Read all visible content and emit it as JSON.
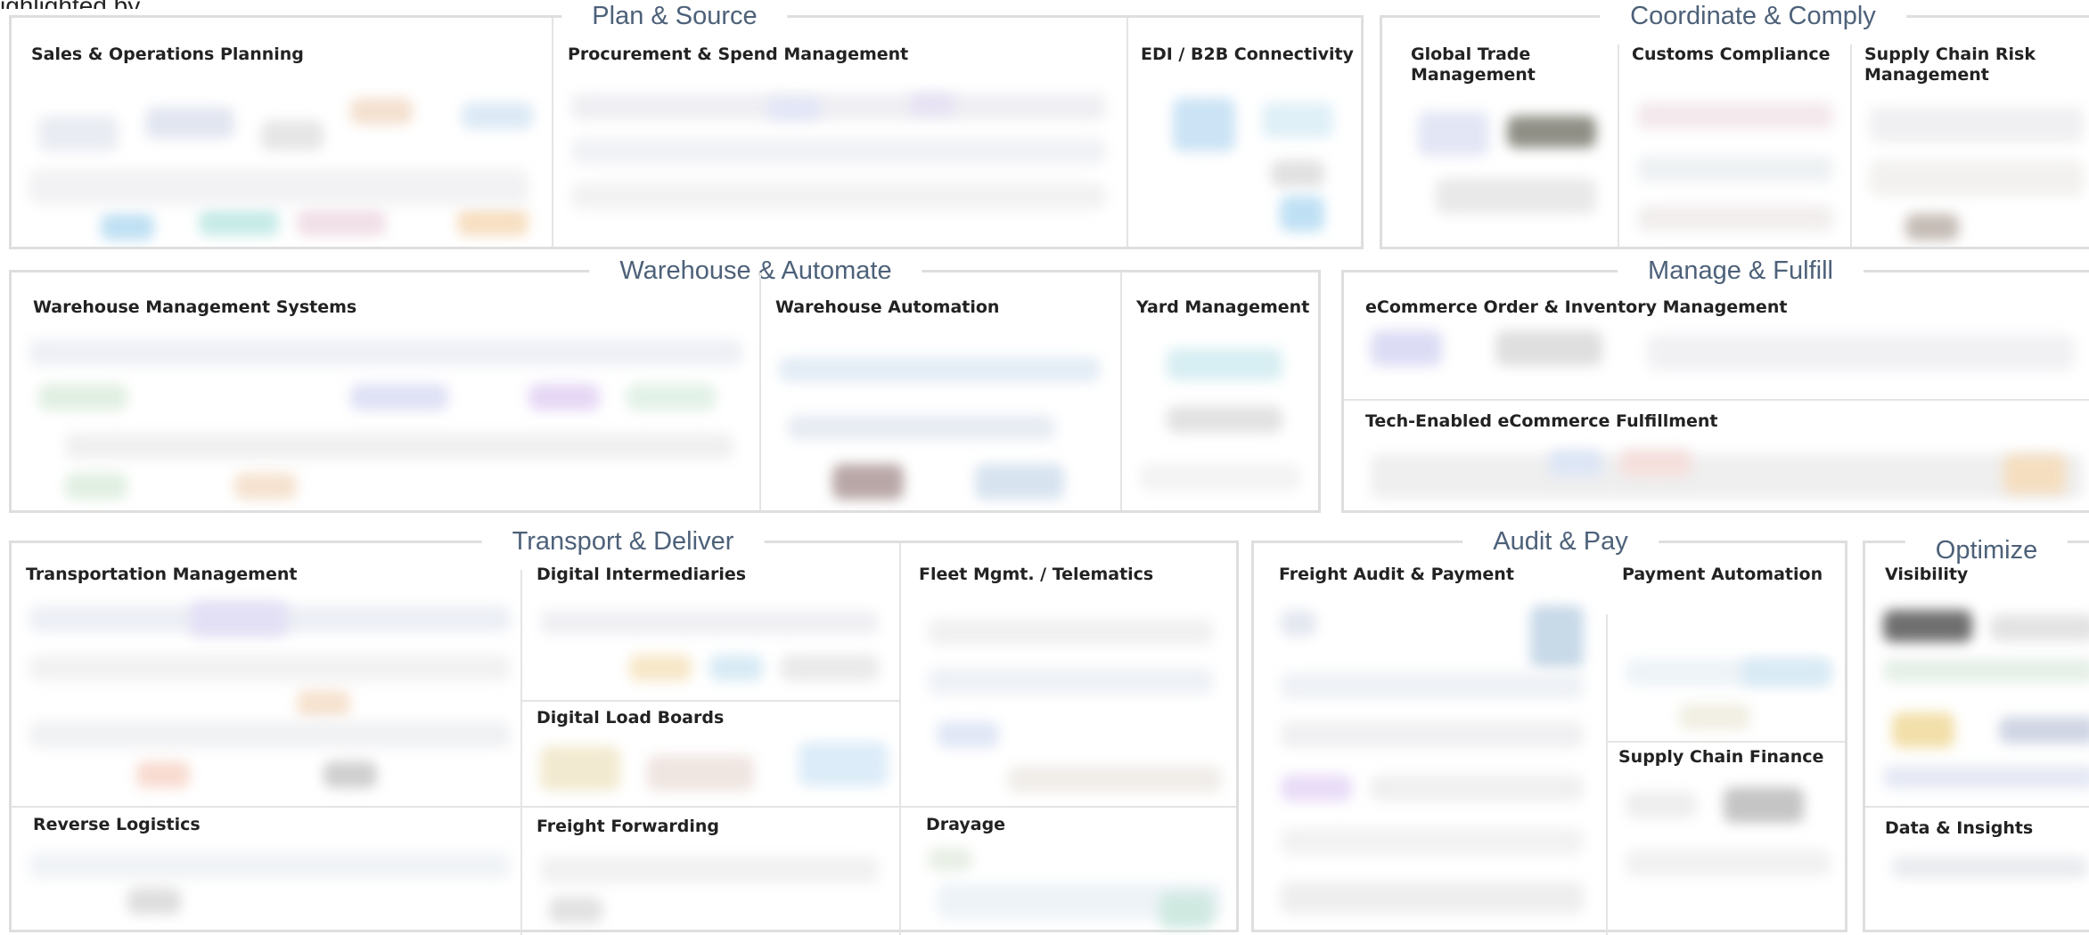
{
  "page": {
    "clipped_top_text": "ighlighted by"
  },
  "sections": {
    "plan_source": {
      "title": "Plan & Source",
      "categories": [
        "Sales & Operations Planning",
        "Procurement & Spend Management",
        "EDI / B2B Connectivity"
      ]
    },
    "coordinate_comply": {
      "title": "Coordinate & Comply",
      "categories": [
        "Global Trade\nManagement",
        "Customs Compliance",
        "Supply Chain Risk\nManagement"
      ]
    },
    "warehouse_automate": {
      "title": "Warehouse & Automate",
      "categories": [
        "Warehouse Management Systems",
        "Warehouse Automation",
        "Yard Management"
      ]
    },
    "manage_fulfill": {
      "title": "Manage & Fulfill",
      "categories": [
        "eCommerce Order & Inventory Management",
        "Tech-Enabled eCommerce Fulfillment"
      ]
    },
    "transport_deliver": {
      "title": "Transport & Deliver",
      "categories": [
        "Transportation Management",
        "Digital Intermediaries",
        "Fleet Mgmt. / Telematics",
        "Digital Load Boards",
        "Reverse Logistics",
        "Freight Forwarding",
        "Drayage"
      ]
    },
    "audit_pay": {
      "title": "Audit & Pay",
      "categories": [
        "Freight Audit & Payment",
        "Payment Automation",
        "Supply Chain Finance"
      ]
    },
    "optimize": {
      "title": "Optimize",
      "categories": [
        "Visibility",
        "Data & Insights"
      ]
    }
  },
  "colors": {
    "frame_border": "#dedede",
    "section_title": "#4d6179",
    "label": "#222222"
  }
}
